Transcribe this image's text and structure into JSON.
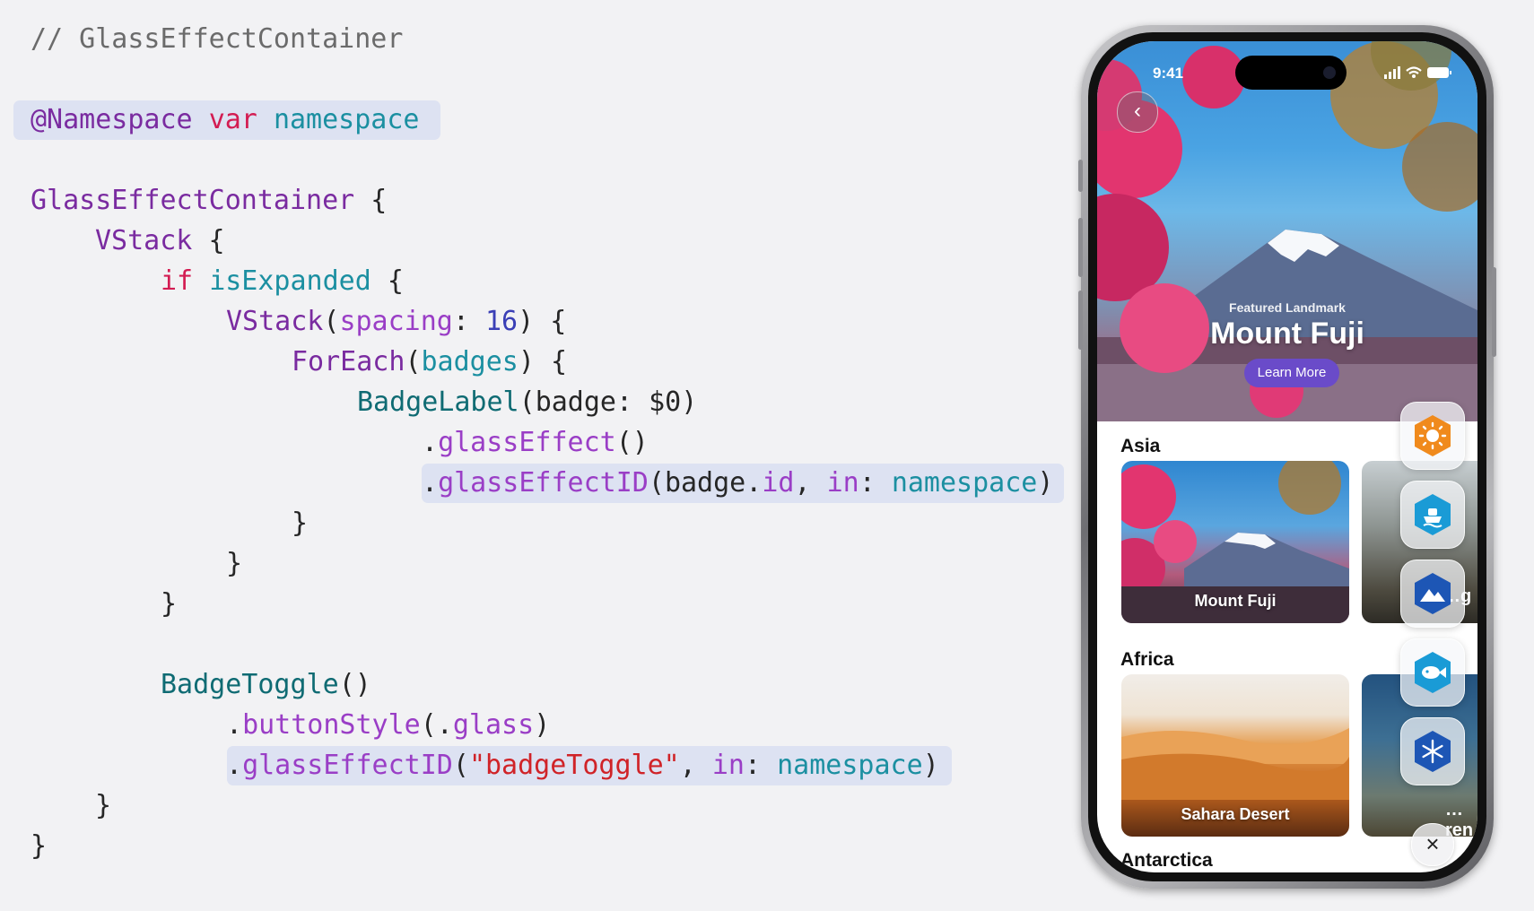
{
  "code": {
    "comment": "// GlassEffectContainer",
    "namespace_attr": "@Namespace",
    "namespace_var_kw": "var",
    "namespace_name": "namespace",
    "container_type": "GlassEffectContainer",
    "open_brace": "{",
    "close_brace": "}",
    "vstack": "VStack",
    "if_kw": "if",
    "is_expanded": "isExpanded",
    "vstack_inner": "VStack",
    "spacing_label": "spacing",
    "spacing_value": "16",
    "foreach": "ForEach",
    "badges": "badges",
    "badge_label": "BadgeLabel",
    "badge_arg": "badge: $0",
    "glass_effect": "glassEffect",
    "glass_effect_id": "glassEffectID",
    "badge_id_obj": "badge",
    "badge_id_prop": "id",
    "in_kw": "in",
    "badge_toggle": "BadgeToggle",
    "button_style": "buttonStyle",
    "glass_value": "glass",
    "badge_toggle_string": "\"badgeToggle\""
  },
  "phone": {
    "status_time": "9:41",
    "hero_subtitle": "Featured Landmark",
    "hero_title": "Mount Fuji",
    "learn_more": "Learn More",
    "sections": [
      {
        "label": "Asia",
        "cards": [
          "Mount Fuji",
          "…g"
        ]
      },
      {
        "label": "Africa",
        "cards": [
          "Sahara Desert",
          "…ren"
        ]
      },
      {
        "label": "Antarctica"
      }
    ],
    "badge_icons": [
      "sun-icon",
      "boat-icon",
      "mountain-icon",
      "fish-icon",
      "snowflake-icon"
    ],
    "colors": {
      "hero_sky": "#4aa3e3",
      "learn_more_button": "#6a4bc9",
      "badge_orange": "#f08a1c",
      "badge_blue": "#1a9bd6",
      "badge_navy": "#1d56b5",
      "highlight": "#dde2f2"
    }
  }
}
